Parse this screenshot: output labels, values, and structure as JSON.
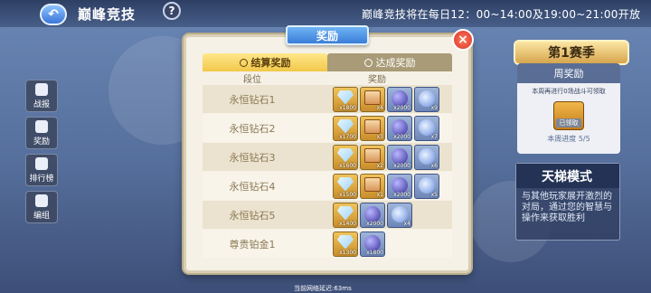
{
  "header": {
    "back_label": "↶",
    "title": "巅峰竞技",
    "help_label": "?",
    "schedule": "巅峰竞技将在每日12：00~14:00及19:00~21:00开放"
  },
  "sidebar": {
    "items": [
      {
        "label": "战报",
        "icon": "battle-report-icon"
      },
      {
        "label": "奖励",
        "icon": "reward-icon"
      },
      {
        "label": "排行榜",
        "icon": "leaderboard-icon"
      },
      {
        "label": "编组",
        "icon": "team-icon"
      }
    ]
  },
  "season": {
    "banner": "第1赛季",
    "weekly": {
      "title": "周奖励",
      "desc": "本周再进行0场战斗可领取",
      "claimed": "已领取",
      "progress": "本周进度 5/5"
    }
  },
  "mode": {
    "title": "天梯模式",
    "desc": "与其他玩家展开激烈的对局，通过您的智慧与操作来获取胜利"
  },
  "dialog": {
    "title": "奖励",
    "close_label": "×",
    "tabs": [
      {
        "label": "结算奖励",
        "active": true
      },
      {
        "label": "达成奖励",
        "active": false
      }
    ],
    "col_rank": "段位",
    "col_reward": "奖励",
    "rows": [
      {
        "rank": "永恒钻石1",
        "items": [
          {
            "type": "diamond",
            "qty": "x1800"
          },
          {
            "type": "card",
            "qty": "x4"
          },
          {
            "type": "orb",
            "qty": "x2000"
          },
          {
            "type": "sphere",
            "qty": "x9"
          }
        ]
      },
      {
        "rank": "永恒钻石2",
        "items": [
          {
            "type": "diamond",
            "qty": "x1700"
          },
          {
            "type": "card",
            "qty": "x3"
          },
          {
            "type": "orb",
            "qty": "x2000"
          },
          {
            "type": "sphere",
            "qty": "x7"
          }
        ]
      },
      {
        "rank": "永恒钻石3",
        "items": [
          {
            "type": "diamond",
            "qty": "x1600"
          },
          {
            "type": "card",
            "qty": "x2"
          },
          {
            "type": "orb",
            "qty": "x2000"
          },
          {
            "type": "sphere",
            "qty": "x6"
          }
        ]
      },
      {
        "rank": "永恒钻石4",
        "items": [
          {
            "type": "diamond",
            "qty": "x1500"
          },
          {
            "type": "card",
            "qty": "x1"
          },
          {
            "type": "orb",
            "qty": "x2000"
          },
          {
            "type": "sphere",
            "qty": "x5"
          }
        ]
      },
      {
        "rank": "永恒钻石5",
        "items": [
          {
            "type": "diamond",
            "qty": "x1400"
          },
          {
            "type": "orb",
            "qty": "x2000"
          },
          {
            "type": "sphere",
            "qty": "x4"
          }
        ]
      },
      {
        "rank": "尊贵铂金1",
        "items": [
          {
            "type": "diamond",
            "qty": "x1300"
          },
          {
            "type": "orb",
            "qty": "x1800"
          }
        ]
      }
    ]
  },
  "footer": {
    "latency": "当前网络延迟:63ms"
  }
}
